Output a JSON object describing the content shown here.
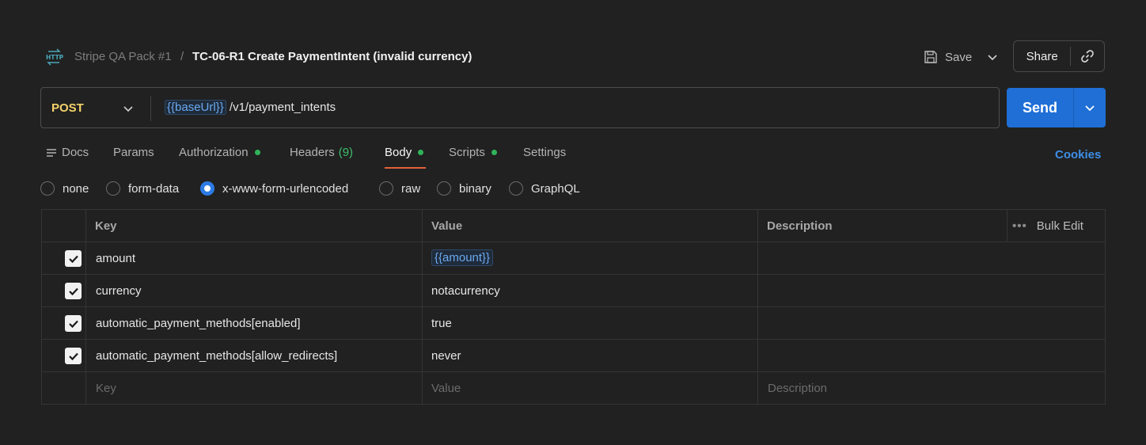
{
  "header": {
    "icon": "http-icon",
    "breadcrumb_parent": "Stripe QA Pack #1",
    "breadcrumb_separator": "/",
    "request_title": "TC-06-R1 Create PaymentIntent (invalid currency)",
    "save_label": "Save",
    "share_label": "Share"
  },
  "request": {
    "method": "POST",
    "url_variable": "{{baseUrl}}",
    "url_path": "/v1/payment_intents",
    "send_label": "Send"
  },
  "tabs": [
    {
      "label": "Docs",
      "icon": "docs-icon"
    },
    {
      "label": "Params"
    },
    {
      "label": "Authorization",
      "dot": true
    },
    {
      "label": "Headers",
      "count": "(9)"
    },
    {
      "label": "Body",
      "dot": true,
      "active": true
    },
    {
      "label": "Scripts",
      "dot": true
    },
    {
      "label": "Settings"
    }
  ],
  "cookies_label": "Cookies",
  "body_types": [
    {
      "label": "none",
      "selected": false
    },
    {
      "label": "form-data",
      "selected": false
    },
    {
      "label": "x-www-form-urlencoded",
      "selected": true
    },
    {
      "label": "raw",
      "selected": false
    },
    {
      "label": "binary",
      "selected": false
    },
    {
      "label": "GraphQL",
      "selected": false
    }
  ],
  "table": {
    "headers": {
      "key": "Key",
      "value": "Value",
      "description": "Description",
      "bulk_edit": "Bulk Edit"
    },
    "rows": [
      {
        "checked": true,
        "key": "amount",
        "value": "{{amount}}",
        "value_is_variable": true,
        "description": ""
      },
      {
        "checked": true,
        "key": "currency",
        "value": "notacurrency",
        "description": ""
      },
      {
        "checked": true,
        "key": "automatic_payment_methods[enabled]",
        "value": "true",
        "description": ""
      },
      {
        "checked": true,
        "key": "automatic_payment_methods[allow_redirects]",
        "value": "never",
        "description": ""
      }
    ],
    "placeholders": {
      "key": "Key",
      "value": "Value",
      "description": "Description"
    }
  },
  "colors": {
    "background": "#212121",
    "method": "#f5d36a",
    "send_button": "#1f6fd6",
    "variable": "#6aa9f0",
    "active_underline": "#e2603a",
    "status_dot": "#2fb35a",
    "link": "#3d8fe8"
  }
}
